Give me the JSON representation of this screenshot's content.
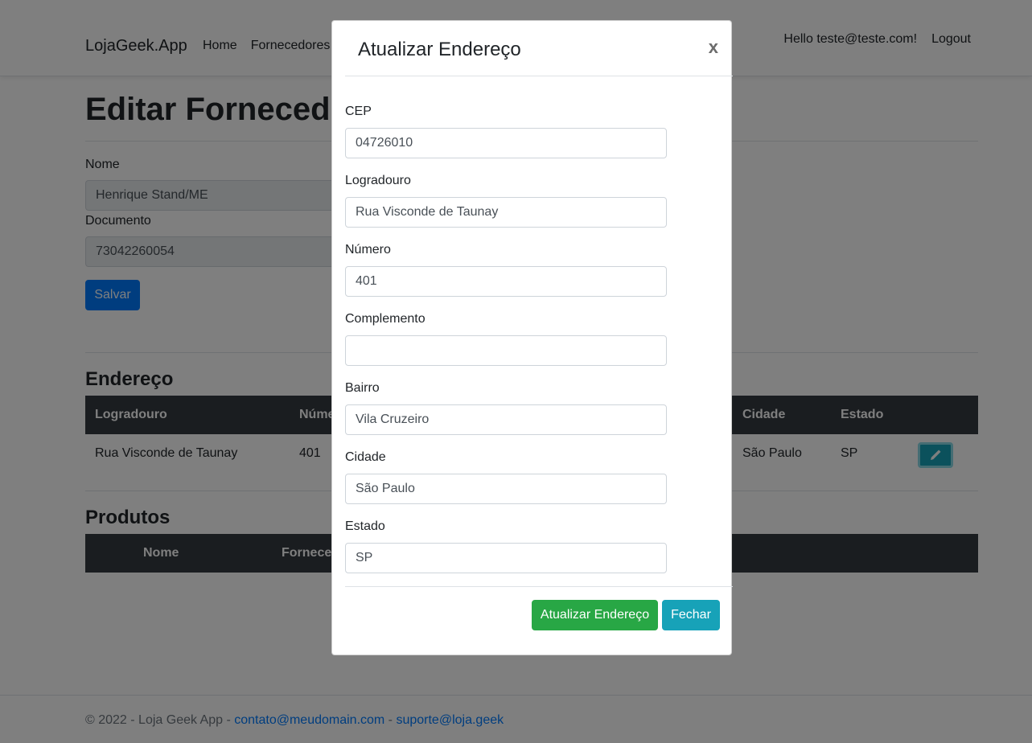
{
  "navbar": {
    "brand": "LojaGeek.App",
    "links": [
      "Home",
      "Fornecedores"
    ],
    "greeting": "Hello teste@teste.com!",
    "logout": "Logout"
  },
  "page": {
    "title": "Editar Fornecedor",
    "nome_label": "Nome",
    "nome_value": "Henrique Stand/ME",
    "documento_label": "Documento",
    "documento_value": "73042260054",
    "save_label": "Salvar"
  },
  "endereco": {
    "title": "Endereço",
    "headers": [
      "Logradouro",
      "Número",
      "Cidade",
      "Estado"
    ],
    "row": {
      "logradouro": "Rua Visconde de Taunay",
      "numero": "401",
      "cidade": "São Paulo",
      "estado": "SP"
    },
    "edit_icon": "pencil-icon"
  },
  "produtos": {
    "title": "Produtos",
    "headers": [
      "Nome",
      "Fornecedor"
    ]
  },
  "footer": {
    "prefix": "© 2022 - Loja Geek App - ",
    "email1": "contato@meudomain.com",
    "sep": " - ",
    "email2": "suporte@loja.geek"
  },
  "modal": {
    "title": "Atualizar Endereço",
    "close": "x",
    "fields": [
      {
        "label": "CEP",
        "value": "04726010"
      },
      {
        "label": "Logradouro",
        "value": "Rua Visconde de Taunay"
      },
      {
        "label": "Número",
        "value": "401"
      },
      {
        "label": "Complemento",
        "value": ""
      },
      {
        "label": "Bairro",
        "value": "Vila Cruzeiro"
      },
      {
        "label": "Cidade",
        "value": "São Paulo"
      },
      {
        "label": "Estado",
        "value": "SP"
      }
    ],
    "submit_label": "Atualizar Endereço",
    "close_label": "Fechar"
  },
  "colors": {
    "primary": "#007bff",
    "success": "#28a745",
    "info": "#17a2b8",
    "dark": "#343a40"
  }
}
